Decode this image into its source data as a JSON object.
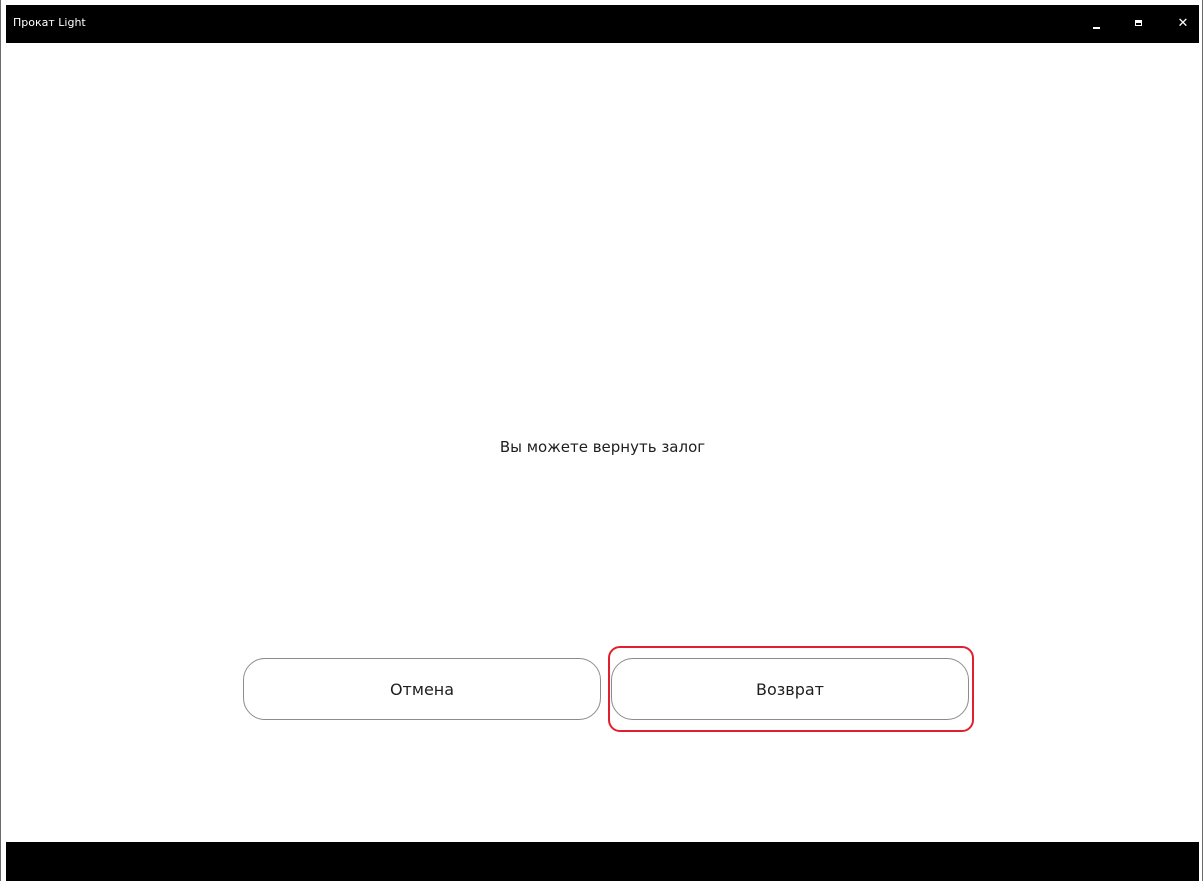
{
  "window": {
    "title": "Прокат Light",
    "controls": {
      "minimize_icon": "minimize-icon",
      "maximize_icon": "maximize-icon",
      "close_icon": "close-icon",
      "close_glyph": "✕"
    }
  },
  "dialog": {
    "message": "Вы можете вернуть залог",
    "buttons": {
      "cancel_label": "Отмена",
      "return_label": "Возврат"
    }
  },
  "colors": {
    "titlebar_bg": "#000000",
    "highlight_border": "#e0202e",
    "button_border": "#8c8c8c"
  }
}
